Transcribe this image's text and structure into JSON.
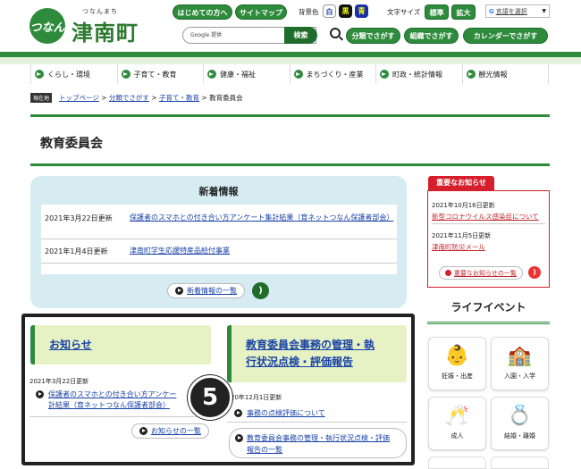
{
  "header": {
    "logo_ruby": "つなんまち",
    "logo_name": "津南町",
    "logo_mark": "つなん",
    "btn_first": "はじめての方へ",
    "btn_sitemap": "サイトマップ",
    "bg_label": "背景色",
    "bg_white": "白",
    "bg_black": "黒",
    "bg_blue": "青",
    "fontsize_label": "文字サイズ",
    "fontsize_std": "標準",
    "fontsize_big": "拡大",
    "lang_label": "言語を選択",
    "search_placeholder": "Google 提供",
    "search_button": "検索",
    "btn_category": "分類でさがす",
    "btn_org": "組織でさがす",
    "btn_calendar": "カレンダーでさがす"
  },
  "nav": [
    {
      "label": "くらし・環境"
    },
    {
      "label": "子育て・教育"
    },
    {
      "label": "健康・福祉"
    },
    {
      "label": "まちづくり・産業"
    },
    {
      "label": "町政・統計情報"
    },
    {
      "label": "観光情報"
    }
  ],
  "breadcrumb": {
    "label": "現在地",
    "top": "トップページ",
    "sep": ">",
    "cat": "分類でさがす",
    "kids": "子育て・教育",
    "current": "教育委員会"
  },
  "page_title": "教育委員会",
  "news": {
    "title": "新着情報",
    "items": [
      {
        "date": "2021年3月22日更新",
        "text": "保護者のスマホとの付き合い方アンケート集計結果（育ネットつなん保護者部会）"
      },
      {
        "date": "2021年1月4日更新",
        "text": "津南町学生応援特産品給付事業"
      }
    ],
    "list_button": "新着情報の一覧"
  },
  "important": {
    "title": "重要なお知らせ",
    "items": [
      {
        "date": "2021年10月16日更新",
        "text": "新型コロナウイルス感染症について"
      },
      {
        "date": "2021年11月5日更新",
        "text": "津南町防災メール"
      }
    ],
    "list_button": "重要なお知らせの一覧"
  },
  "life": {
    "title": "ライフイベント",
    "items": [
      {
        "label": "妊娠・出産",
        "icon": "👶"
      },
      {
        "label": "入園・入学",
        "icon": "🏫"
      },
      {
        "label": "成人",
        "icon": "🥂"
      },
      {
        "label": "結婚・離婚",
        "icon": "💍"
      }
    ]
  },
  "notices": {
    "title": "お知らせ",
    "date": "2021年3月22日更新",
    "item": "保護者のスマホとの付き合い方アンケート集計結果（育ネットつなん保護者部会）",
    "item_visible_1": "保護者のスマホとの付き合い方アンケー",
    "item_visible_2": "計結果（育ネットつなん保護者部会）",
    "list_button": "お知らせの一覧"
  },
  "evaluation": {
    "title_line1": "教育委員会事務の管理・執",
    "title_line2": "行状況点検・評価報告",
    "date": "20年12月1日更新",
    "item": "事務の点検評価について",
    "list_line1": "教育委員会事務の管理・執行状況点検・評価",
    "list_line2": "報告の一覧"
  },
  "step_badge": "5"
}
